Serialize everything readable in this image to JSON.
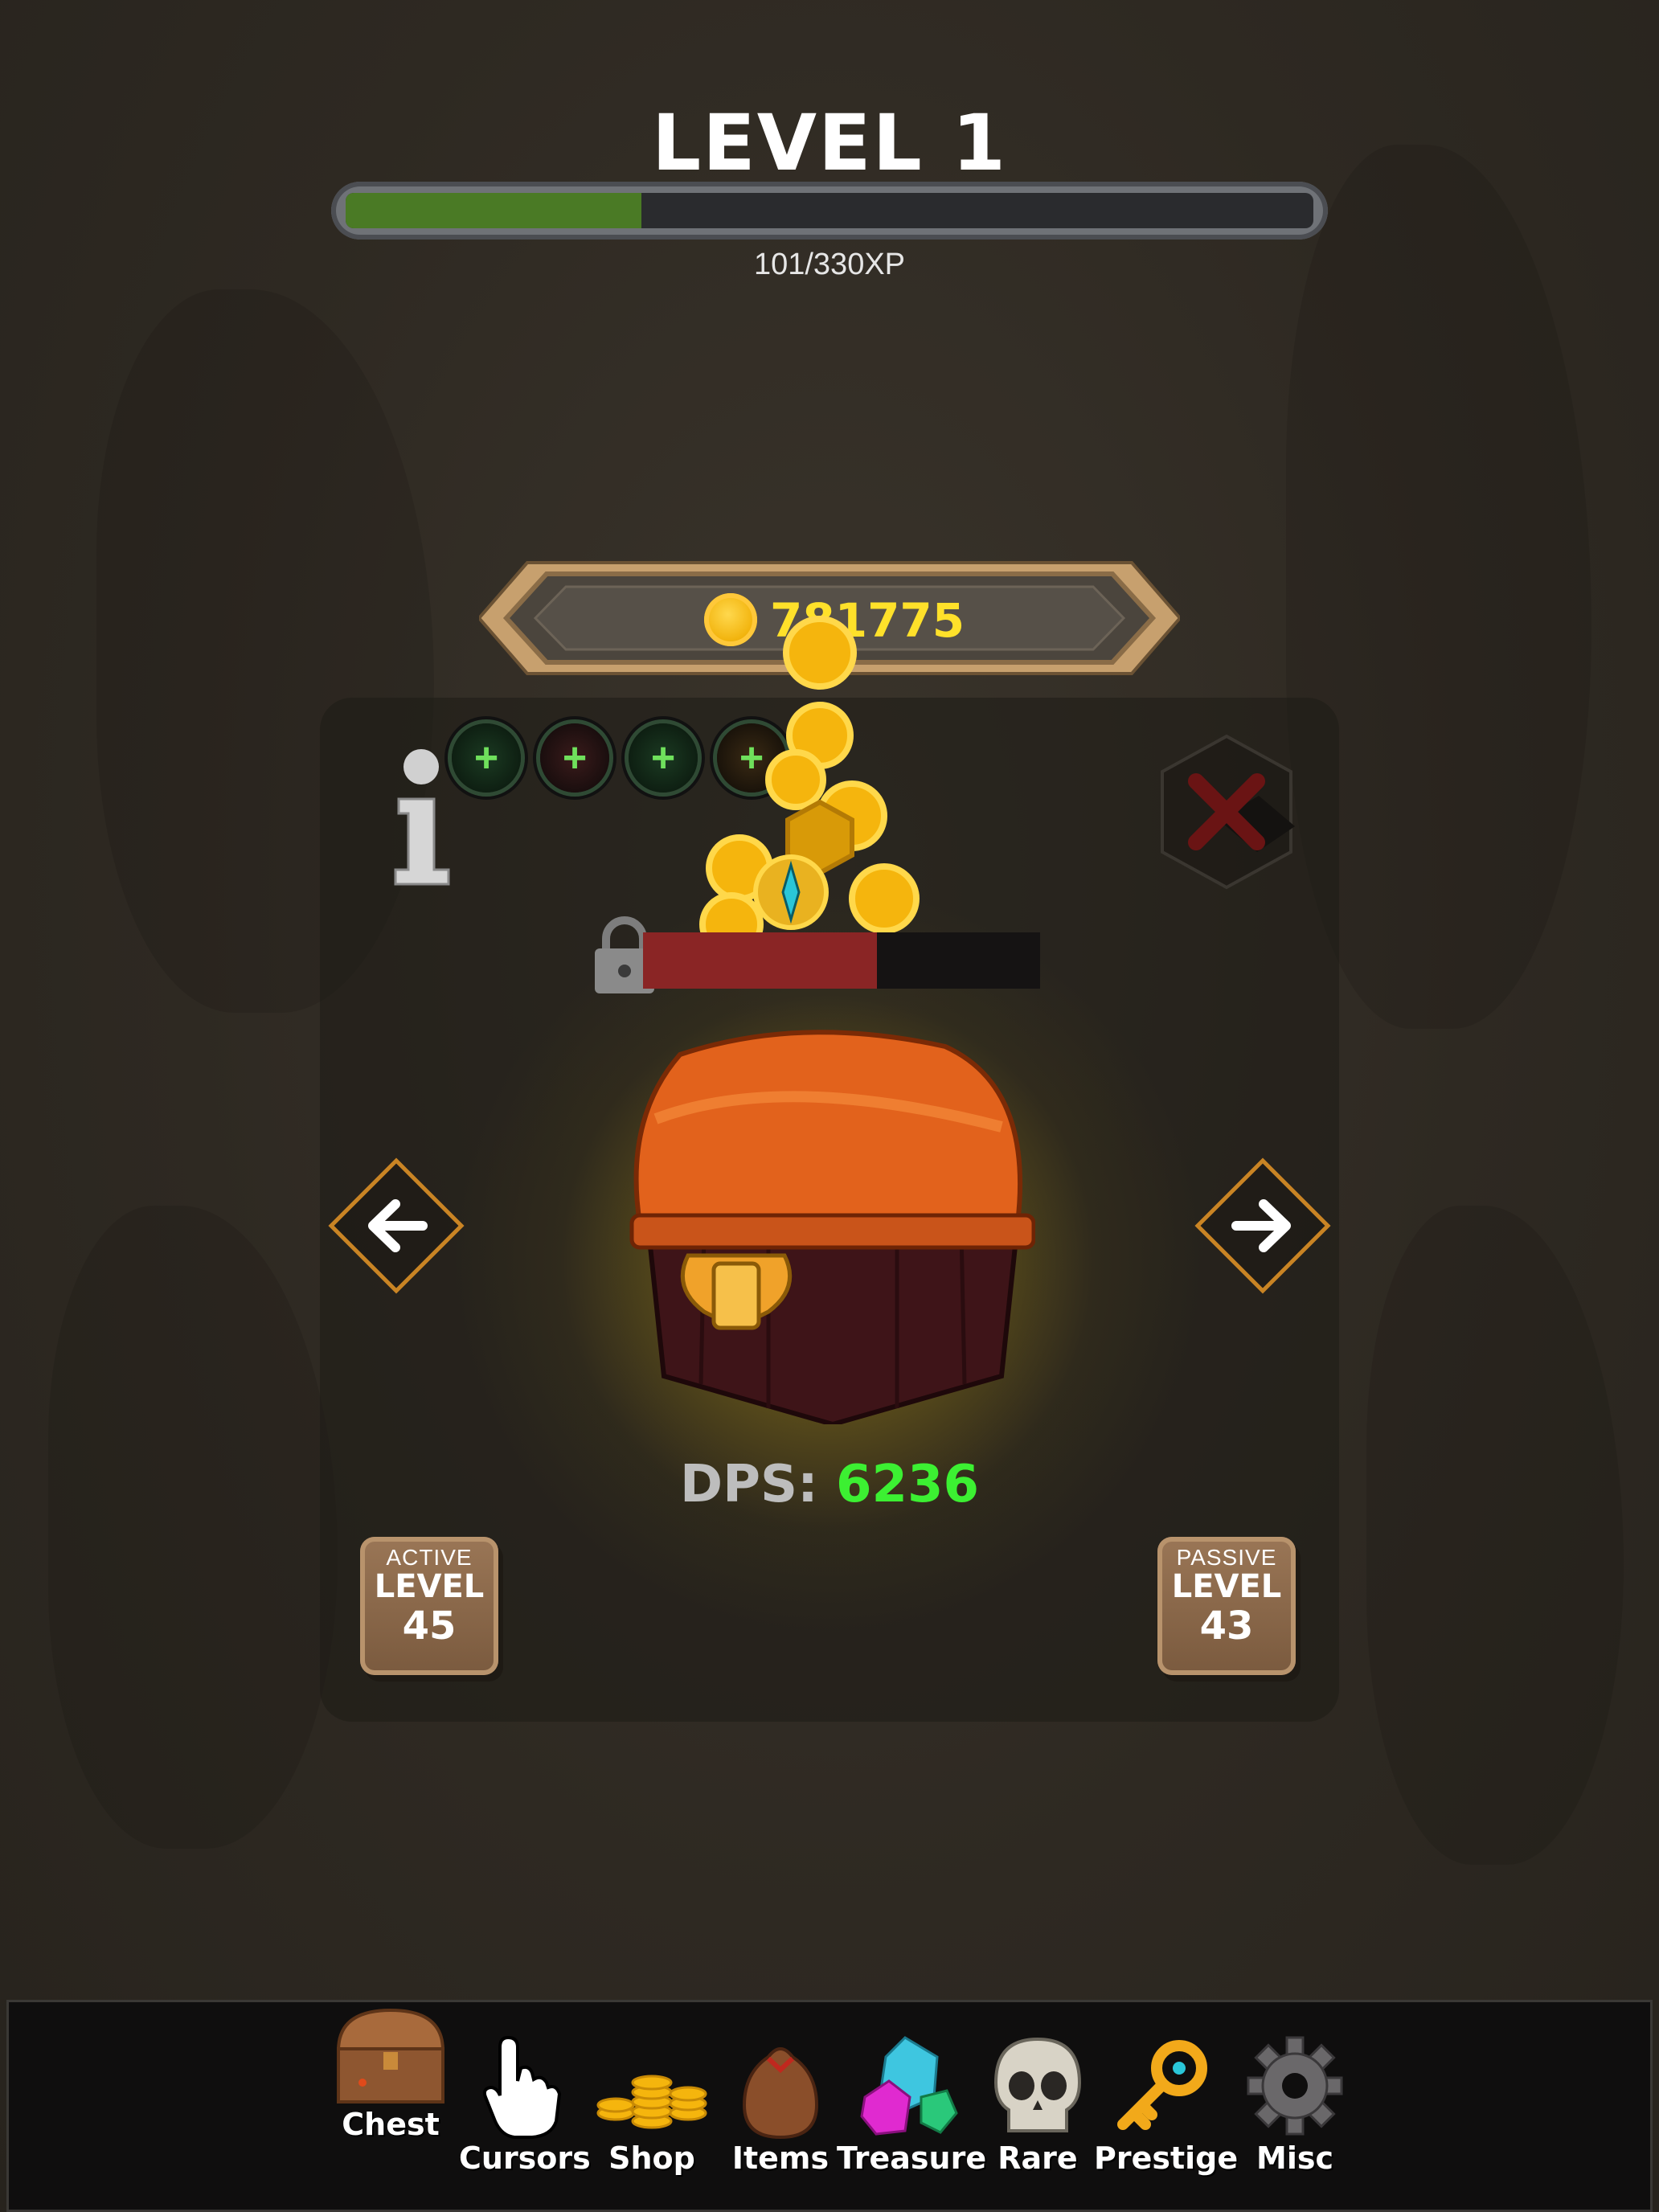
{
  "header": {
    "level_title": "LEVEL 1",
    "xp_text": "101/330XP",
    "xp_current": 101,
    "xp_max": 330
  },
  "gold": {
    "icon": "gold-coin-icon",
    "amount": "781775"
  },
  "boosts": [
    {
      "icon": "green-potion-icon"
    },
    {
      "icon": "red-potion-icon"
    },
    {
      "icon": "green-flask-icon"
    },
    {
      "icon": "orange-potion-icon"
    }
  ],
  "chest": {
    "health_fraction": 0.59,
    "dps_label": "DPS: ",
    "dps_value": "6236"
  },
  "active_level": {
    "caption": "ACTIVE",
    "label": "LEVEL",
    "value": "45"
  },
  "passive_level": {
    "caption": "PASSIVE",
    "label": "LEVEL",
    "value": "43"
  },
  "bottom_nav": {
    "items": [
      {
        "label": "Chest",
        "icon": "chest-icon"
      },
      {
        "label": "Cursors",
        "icon": "hand-cursor-icon"
      },
      {
        "label": "Shop",
        "icon": "coin-pile-icon"
      },
      {
        "label": "Items",
        "icon": "sack-icon"
      },
      {
        "label": "Treasure",
        "icon": "gems-icon"
      },
      {
        "label": "Rare",
        "icon": "skull-icon"
      },
      {
        "label": "Prestige",
        "icon": "key-icon"
      },
      {
        "label": "Misc",
        "icon": "gear-icon"
      }
    ]
  },
  "colors": {
    "xp_fill": "#4a7a25",
    "gold_text": "#ffe12a",
    "dps_value": "#3cf032",
    "hp_fill": "#8a2525",
    "accent_arrow": "#c98424"
  }
}
